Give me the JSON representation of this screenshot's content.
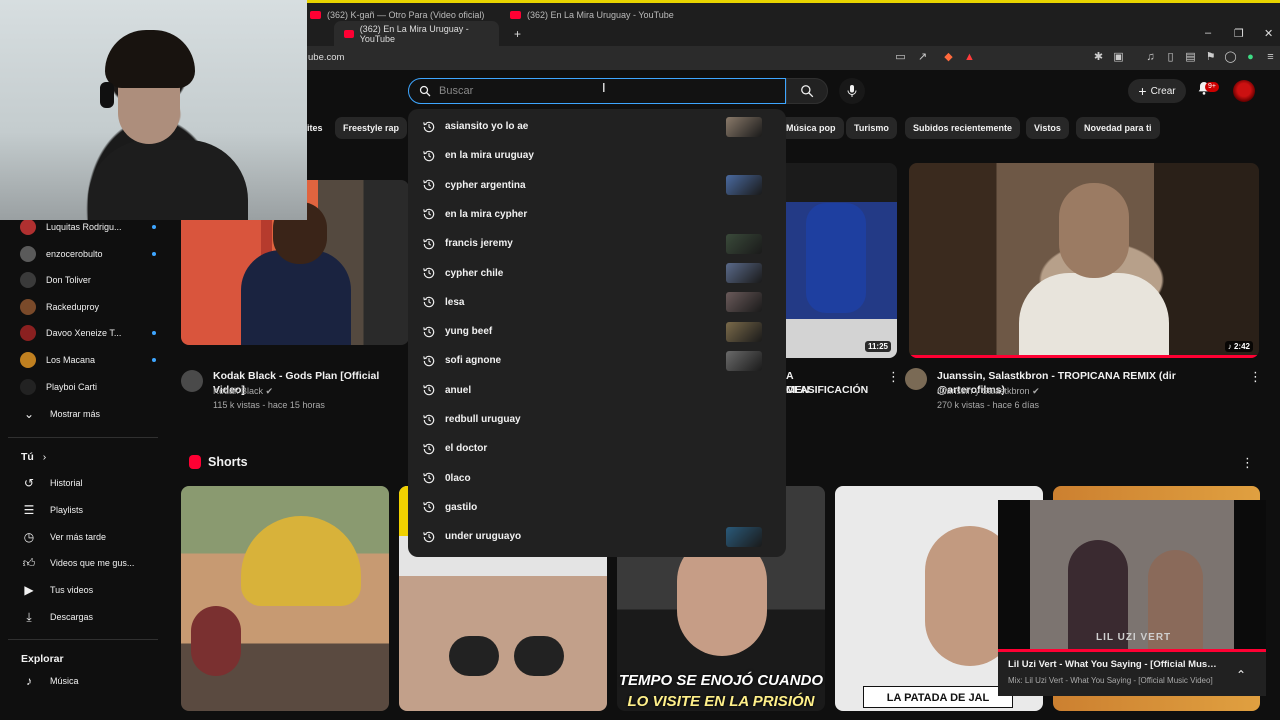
{
  "browser": {
    "tabs": [
      {
        "label": "(362) K-gañ — Otro Para (Video oficial)"
      },
      {
        "label": "(362) En La Mira Uruguay - YouTube"
      },
      {
        "label": "(362) En La Mira Uruguay - YouTube"
      }
    ],
    "url": "ube.com",
    "new_tab": "+",
    "win_min": "–",
    "win_max": "❐",
    "win_close": "✕"
  },
  "header": {
    "search_placeholder": "Buscar",
    "create_label": "Crear",
    "notif_badge": "9+"
  },
  "chips": [
    "ites",
    "Freestyle rap",
    "Música pop",
    "Turismo",
    "Subidos recientemente",
    "Vistos",
    "Novedad para ti"
  ],
  "suggestions": [
    {
      "text": "asiansito yo lo ae",
      "thumb": true
    },
    {
      "text": "en la mira uruguay",
      "thumb": false
    },
    {
      "text": "cypher argentina",
      "thumb": true
    },
    {
      "text": "en la mira cypher",
      "thumb": false
    },
    {
      "text": "francis jeremy",
      "thumb": true
    },
    {
      "text": "cypher chile",
      "thumb": true
    },
    {
      "text": "lesa",
      "thumb": true
    },
    {
      "text": "yung beef",
      "thumb": true
    },
    {
      "text": "sofi agnone",
      "thumb": true
    },
    {
      "text": "anuel",
      "thumb": false
    },
    {
      "text": "redbull uruguay",
      "thumb": false
    },
    {
      "text": "el doctor",
      "thumb": false
    },
    {
      "text": "0laco",
      "thumb": false
    },
    {
      "text": "gastilo",
      "thumb": false
    },
    {
      "text": "under uruguayo",
      "thumb": true
    }
  ],
  "sidebar": {
    "subscriptions": [
      {
        "name": "Luquitas Rodrigu...",
        "live": true,
        "color": "#b03030"
      },
      {
        "name": "enzocerobulto",
        "live": true,
        "color": "#5a5a5a"
      },
      {
        "name": "Don Toliver",
        "live": false,
        "color": "#3a3a3a"
      },
      {
        "name": "Rackeduproy",
        "live": false,
        "color": "#7a4a2a"
      },
      {
        "name": "Davoo Xeneize T...",
        "live": true,
        "color": "#8a2020"
      },
      {
        "name": "Los Macana",
        "live": true,
        "color": "#c08020"
      },
      {
        "name": "Playboi Carti",
        "live": false,
        "color": "#222222"
      }
    ],
    "show_more": "Mostrar más",
    "you_heading": "Tú",
    "you_items": [
      {
        "label": "Historial",
        "icon": "history-icon"
      },
      {
        "label": "Playlists",
        "icon": "playlists-icon"
      },
      {
        "label": "Ver más tarde",
        "icon": "watch-later-icon"
      },
      {
        "label": "Videos que me gus...",
        "icon": "liked-videos-icon"
      },
      {
        "label": "Tus videos",
        "icon": "your-videos-icon"
      },
      {
        "label": "Descargas",
        "icon": "downloads-icon"
      }
    ],
    "explore_heading": "Explorar",
    "explore_items": [
      {
        "label": "Música",
        "icon": "music-icon"
      }
    ]
  },
  "videos": [
    {
      "title": "Kodak Black - Gods Plan [Official Video]",
      "title2": "",
      "channel": "Kodak Black",
      "meta": "115 k vistas - hace 15 horas",
      "duration": ""
    },
    {
      "title": "A CLASIFICACIÓN",
      "title2": "MEN",
      "channel": "",
      "meta": "",
      "duration": "11:25"
    },
    {
      "title": "Juanssin, Salastkbron - TROPICANA REMIX (dir @arterofilms)",
      "title2": "",
      "channel": "Juanssin  y Salastkbron",
      "meta": "270 k vistas - hace 6 días",
      "duration": "2:42"
    }
  ],
  "shorts": {
    "heading": "Shorts",
    "captions": [
      "TEMPO SE ENOJÓ CUANDO",
      "LO VISITE EN LA PRISIÓN",
      "LA PATADA DE JAL"
    ]
  },
  "miniplayer": {
    "title": "Lil Uzi Vert - What You Saying - [Official Music Vi...",
    "subtitle": "Mix: Lil Uzi Vert - What You Saying - [Official Music Video]",
    "watermark": "LIL UZI VERT"
  },
  "colors": {
    "background": "#0f0f0f",
    "accent_blue": "#3ea6ff",
    "youtube_red": "#ff0033",
    "dropdown_bg": "#212121",
    "chip_bg": "#272727"
  }
}
